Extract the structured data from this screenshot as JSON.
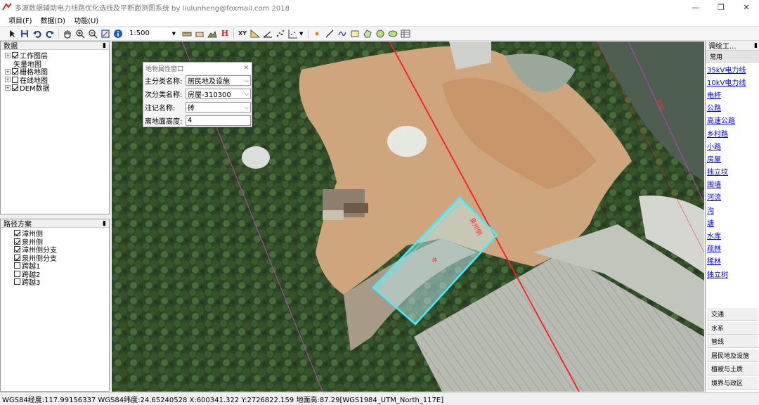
{
  "window": {
    "title": "多源数据辅助电力线路优化选线及平断面测图系统 by liulunheng@foxmail.com 2018",
    "min_glyph": "—",
    "max_glyph": "❐",
    "close_glyph": "✕"
  },
  "menu": [
    "项目(F)",
    "数据(D)",
    "功能(U)"
  ],
  "toolbar": {
    "scale": "1:500",
    "h_label": "H",
    "xy_label": "XY"
  },
  "data_panel": {
    "title": "数据",
    "pin": "▮",
    "items": [
      {
        "label": "工作图层",
        "checked": true,
        "expander": "+",
        "indent": 0
      },
      {
        "label": "矢量地图",
        "checked": null,
        "expander": null,
        "indent": 1
      },
      {
        "label": "栅格地图",
        "checked": true,
        "expander": "+",
        "indent": 0
      },
      {
        "label": "在线地图",
        "checked": false,
        "expander": "+",
        "indent": 0
      },
      {
        "label": "DEM数据",
        "checked": true,
        "expander": "+",
        "indent": 0
      }
    ]
  },
  "route_panel": {
    "title": "路径方案",
    "pin": "▮",
    "items": [
      {
        "label": "漳州侧",
        "checked": true
      },
      {
        "label": "泉州侧",
        "checked": true
      },
      {
        "label": "漳州侧分支",
        "checked": true
      },
      {
        "label": "泉州侧分支",
        "checked": true
      },
      {
        "label": "跨越1",
        "checked": false
      },
      {
        "label": "跨越2",
        "checked": false
      },
      {
        "label": "跨越3",
        "checked": false
      }
    ]
  },
  "attr_window": {
    "title": "地物属性窗口",
    "close": "✕",
    "rows": [
      {
        "label": "主分类名称:",
        "value": "居民地及设施",
        "dropdown": true
      },
      {
        "label": "次分类名称:",
        "value": "房屋-310300",
        "dropdown": true
      },
      {
        "label": "注记名称:",
        "value": "砖",
        "dropdown": true
      },
      {
        "label": "离地面高度:",
        "value": "4",
        "dropdown": false
      }
    ]
  },
  "map": {
    "line_label_a": "泉州侧",
    "line_label_b": "泉州",
    "building_note": "砖",
    "colors": {
      "line": "#ff1a1a",
      "building": "#3ff0ff",
      "guide": "#c040c0"
    }
  },
  "right_panel": {
    "title": "调绘工...",
    "pin": "▮",
    "tab_common": "常用",
    "links": [
      "35kV电力线",
      "10kV电力线",
      "电杆",
      "公路",
      "高速公路",
      "乡村路",
      "小路",
      "房屋",
      "独立坟",
      "围墙",
      "河流",
      "沟",
      "塘",
      "水库",
      "疏林",
      "稀林",
      "独立树"
    ],
    "categories": [
      "交通",
      "水系",
      "管线",
      "居民地及设施",
      "植被与土质",
      "境界与政区"
    ]
  },
  "status": "WGS84经度:117.99156337 WGS84纬度:24.65240528 X:600341.322 Y:2726822.159 地面高:87.29[WGS1984_UTM_North_117E]"
}
